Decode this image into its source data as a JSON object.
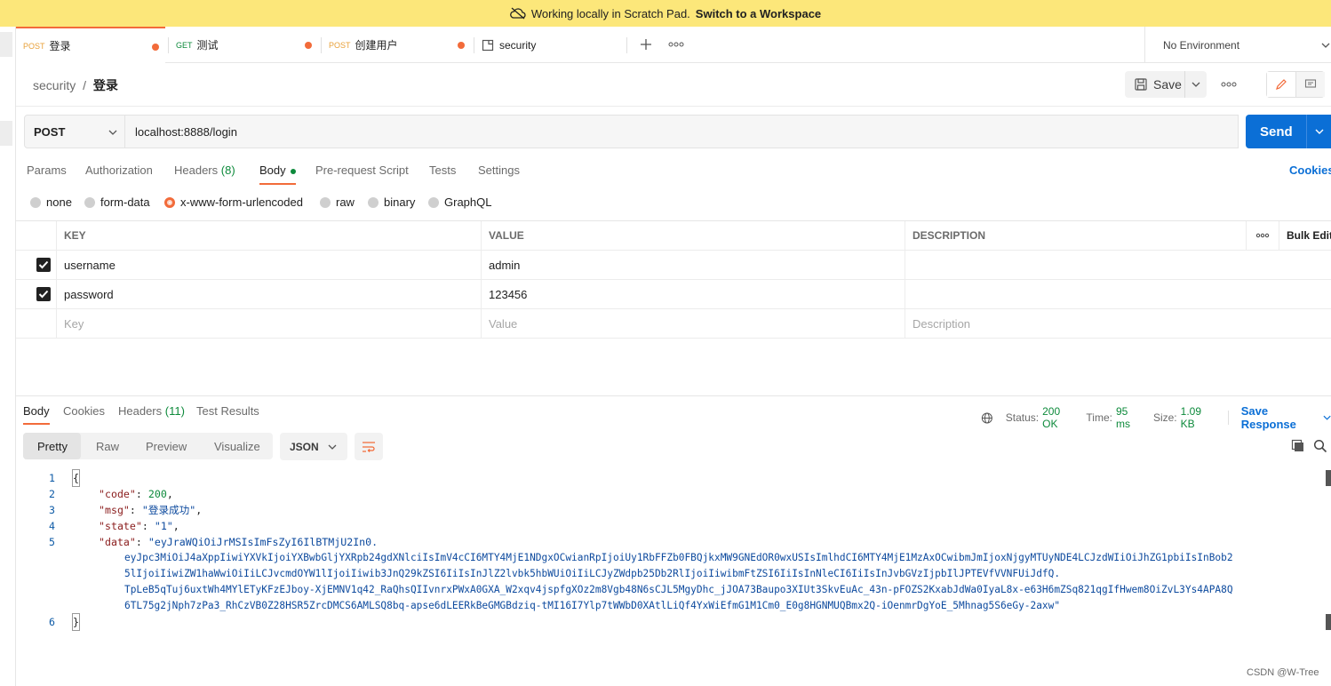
{
  "banner": {
    "text": "Working locally in Scratch Pad.",
    "link": "Switch to a Workspace"
  },
  "tabs": [
    {
      "method": "POST",
      "method_color": "#e8a13a",
      "name": "登录",
      "unsaved": true,
      "active": true
    },
    {
      "method": "GET",
      "method_color": "#0d8a3b",
      "name": "测试",
      "unsaved": true
    },
    {
      "method": "POST",
      "method_color": "#e8a13a",
      "name": "创建用户",
      "unsaved": true
    },
    {
      "method": "",
      "name": "security",
      "icon": "document-icon"
    }
  ],
  "environment": {
    "label": "No Environment"
  },
  "breadcrumb": {
    "collection": "security",
    "separator": "/",
    "request": "登录"
  },
  "toolbar": {
    "save_label": "Save"
  },
  "request": {
    "method": "POST",
    "url": "localhost:8888/login",
    "send_label": "Send"
  },
  "request_tabs": [
    {
      "label": "Params"
    },
    {
      "label": "Authorization"
    },
    {
      "label": "Headers",
      "count": "(8)"
    },
    {
      "label": "Body",
      "active": true
    },
    {
      "label": "Pre-request Script"
    },
    {
      "label": "Tests"
    },
    {
      "label": "Settings"
    }
  ],
  "cookies_link": "Cookies",
  "body_types": [
    "none",
    "form-data",
    "x-www-form-urlencoded",
    "raw",
    "binary",
    "GraphQL"
  ],
  "body_type_selected": "x-www-form-urlencoded",
  "kv_table": {
    "headers": {
      "key": "KEY",
      "value": "VALUE",
      "description": "DESCRIPTION",
      "bulk": "Bulk Edit"
    },
    "rows": [
      {
        "checked": true,
        "key": "username",
        "value": "admin",
        "description": ""
      },
      {
        "checked": true,
        "key": "password",
        "value": "123456",
        "description": ""
      }
    ],
    "placeholders": {
      "key": "Key",
      "value": "Value",
      "description": "Description"
    }
  },
  "response_tabs": [
    {
      "label": "Body",
      "active": true
    },
    {
      "label": "Cookies"
    },
    {
      "label": "Headers",
      "count": "(11)"
    },
    {
      "label": "Test Results"
    }
  ],
  "response_status": {
    "status_label": "Status:",
    "status": "200 OK",
    "time_label": "Time:",
    "time": "95 ms",
    "size_label": "Size:",
    "size": "1.09 KB",
    "save_response": "Save Response"
  },
  "view_modes": [
    "Pretty",
    "Raw",
    "Preview",
    "Visualize"
  ],
  "format": "JSON",
  "code": {
    "line_numbers": [
      "1",
      "2",
      "3",
      "4",
      "5",
      "6"
    ],
    "open_brace": "{",
    "close_brace": "}",
    "code_key": "\"code\"",
    "code_val": "200",
    "msg_key": "\"msg\"",
    "msg_val": "\"登录成功\"",
    "state_key": "\"state\"",
    "state_val": "\"1\"",
    "data_key": "\"data\"",
    "data_lines": [
      "\"eyJraWQiOiJrMSIsImFsZyI6IlBTMjU2In0.",
      "eyJpc3MiOiJ4aXppIiwiYXVkIjoiYXBwbGljYXRpb24gdXNlciIsImV4cCI6MTY4MjE1NDgxOCwianRpIjoiUy1RbFFZb0FBQjkxMW9GNEdOR0wxUSIsImlhdCI6MTY4MjE1MzAxOCwibmJmIjoxNjgyMTUyNDE4LCJzdWIiOiJhZG1pbiIsInBob2",
      "5lIjoiIiwiZW1haWwiOiIiLCJvcmdOYW1lIjoiIiwib3JnQ29kZSI6IiIsInJlZ2lvbk5hbWUiOiIiLCJyZWdpb25Db2RlIjoiIiwibmFtZSI6IiIsInNleCI6IiIsInJvbGVzIjpbIlJPTEVfVVNFUiJdfQ.",
      "TpLeB5qTuj6uxtWh4MYlETyKFzEJboy-XjEMNV1q42_RaQhsQIIvnrxPWxA0GXA_W2xqv4jspfgXOz2m8Vgb48N6sCJL5MgyDhc_jJOA73Baupo3XIUt3SkvEuAc_43n-pFOZS2KxabJdWa0IyaL8x-e63H6mZSq821qgIfHwem8OiZvL3Ys4APA8Q",
      "6TL75g2jNph7zPa3_RhCzVB0Z28HSR5ZrcDMCS6AMLSQ8bq-apse6dLEERkBeGMGBdziq-tMI16I7Ylp7tWWbD0XAtlLiQf4YxWiEfmG1M1Cm0_E0g8HGNMUQBmx2Q-iOenmrDgYoE_5Mhnag5S6eGy-2axw\""
    ]
  },
  "watermark": "CSDN @W-Tree",
  "colors": {
    "accent": "#f26b3a",
    "send": "#0b6fd6",
    "banner": "#fce77a",
    "link": "#0b6fd6",
    "success": "#0d8a3b"
  }
}
